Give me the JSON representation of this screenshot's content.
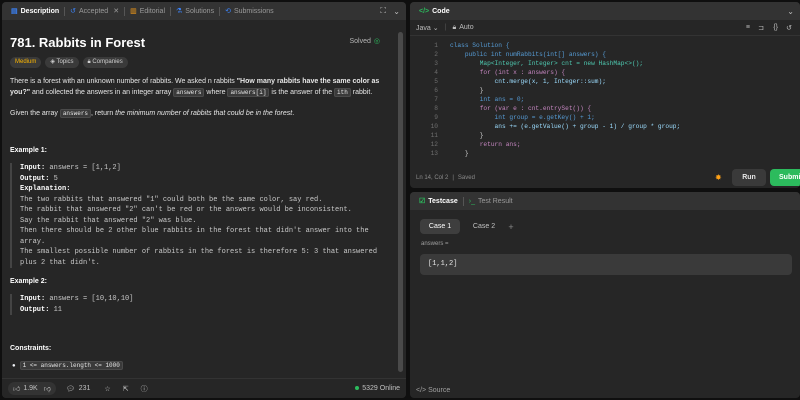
{
  "left_tabs": [
    {
      "label": "Description",
      "icon": "doc-icon"
    },
    {
      "label": "Accepted",
      "icon": "history-icon"
    },
    {
      "label": "Editorial",
      "icon": "book-icon"
    },
    {
      "label": "Solutions",
      "icon": "flask-icon"
    },
    {
      "label": "Submissions",
      "icon": "clock-icon"
    }
  ],
  "problem": {
    "title": "781. Rabbits in Forest",
    "status": "Solved",
    "tags": [
      "Medium",
      "Topics",
      "Companies"
    ],
    "para1_a": "There is a forest with an unknown number of rabbits. We asked n rabbits ",
    "para1_bold": "\"How many rabbits have the same color as you?\"",
    "para1_b": " and collected the answers in an integer array ",
    "para1_code1": "answers",
    "para1_c": " where ",
    "para1_code2": "answers[i]",
    "para1_d": " is the answer of the ",
    "para1_sup": "ith",
    "para1_e": " rabbit.",
    "para2_a": "Given the array ",
    "para2_code": "answers",
    "para2_b": ", return ",
    "para2_italic": "the minimum number of rabbits that could be in the forest",
    "para2_c": "."
  },
  "example1": {
    "heading": "Example 1:",
    "input_label": "Input:",
    "input_value": " answers = [1,1,2]",
    "output_label": "Output:",
    "output_value": " 5",
    "expl_label": "Explanation:",
    "lines": [
      "The two rabbits that answered \"1\" could both be the same color, say red.",
      "The rabbit that answered \"2\" can't be red or the answers would be inconsistent.",
      "Say the rabbit that answered \"2\" was blue.",
      "Then there should be 2 other blue rabbits in the forest that didn't answer into the",
      "array.",
      "The smallest possible number of rabbits in the forest is therefore 5: 3 that answered",
      "plus 2 that didn't."
    ]
  },
  "example2": {
    "heading": "Example 2:",
    "input_label": "Input:",
    "input_value": " answers = [10,10,10]",
    "output_label": "Output:",
    "output_value": " 11"
  },
  "constraints": {
    "heading": "Constraints:",
    "item1": "1 <= answers.length <= 1000"
  },
  "left_footer": {
    "likes": "1.9K",
    "comments": "231",
    "online": "5329 Online"
  },
  "code_panel": {
    "title": "Code",
    "language": "Java",
    "mode": "Auto",
    "status_pos": "Ln 14, Col 2",
    "status_saved": "Saved",
    "run_label": "Run",
    "submit_label": "Submit"
  },
  "code_lines": [
    "class Solution {",
    "    public int numRabbits(int[] answers) {",
    "        Map<Integer, Integer> cnt = new HashMap<>();",
    "        for (int x : answers) {",
    "            cnt.merge(x, 1, Integer::sum);",
    "        }",
    "        int ans = 0;",
    "        for (var e : cnt.entrySet()) {",
    "            int group = e.getKey() + 1;",
    "            ans += (e.getValue() + group - 1) / group * group;",
    "        }",
    "        return ans;",
    "    }"
  ],
  "line_numbers": [
    "1",
    "2",
    "3",
    "4",
    "5",
    "6",
    "7",
    "8",
    "9",
    "10",
    "11",
    "12",
    "13"
  ],
  "test_panel": {
    "tab_testcase": "Testcase",
    "tab_result": "Test Result",
    "case1": "Case 1",
    "case2": "Case 2",
    "add": "+",
    "var_label": "answers =",
    "var_value": "[1,1,2]",
    "source": "Source"
  },
  "colors": {
    "accent_green": "#2cbb5d",
    "medium": "#ffb800",
    "code_accent": "#2cbb5d"
  }
}
